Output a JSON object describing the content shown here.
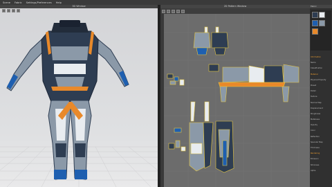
{
  "menubar": {
    "items": [
      "Scene",
      "Fabric",
      "Settings/Preferences",
      "Help"
    ]
  },
  "viewport3d": {
    "title": "3D Window"
  },
  "viewport2d": {
    "title": "2D Pattern Window"
  },
  "panel": {
    "header": "Fabric",
    "sections": [
      "Information",
      "Name",
      "Classification",
      "Material",
      "Physical Property",
      "Preset",
      "Detail",
      "Texture",
      "Normal Map",
      "Displacement",
      "Roughness",
      "Metalness",
      "Opacity",
      "Color",
      "Reflection",
      "Specular Map",
      "Thickness",
      "Rendering",
      "Emission",
      "Shininess",
      "Alpha"
    ]
  },
  "colors": {
    "fabric_dark": "#2e3d52",
    "fabric_grey": "#8b99a8",
    "fabric_blue": "#1e5fb0",
    "accent_orange": "#e8892a",
    "white": "#e8ecf0"
  }
}
